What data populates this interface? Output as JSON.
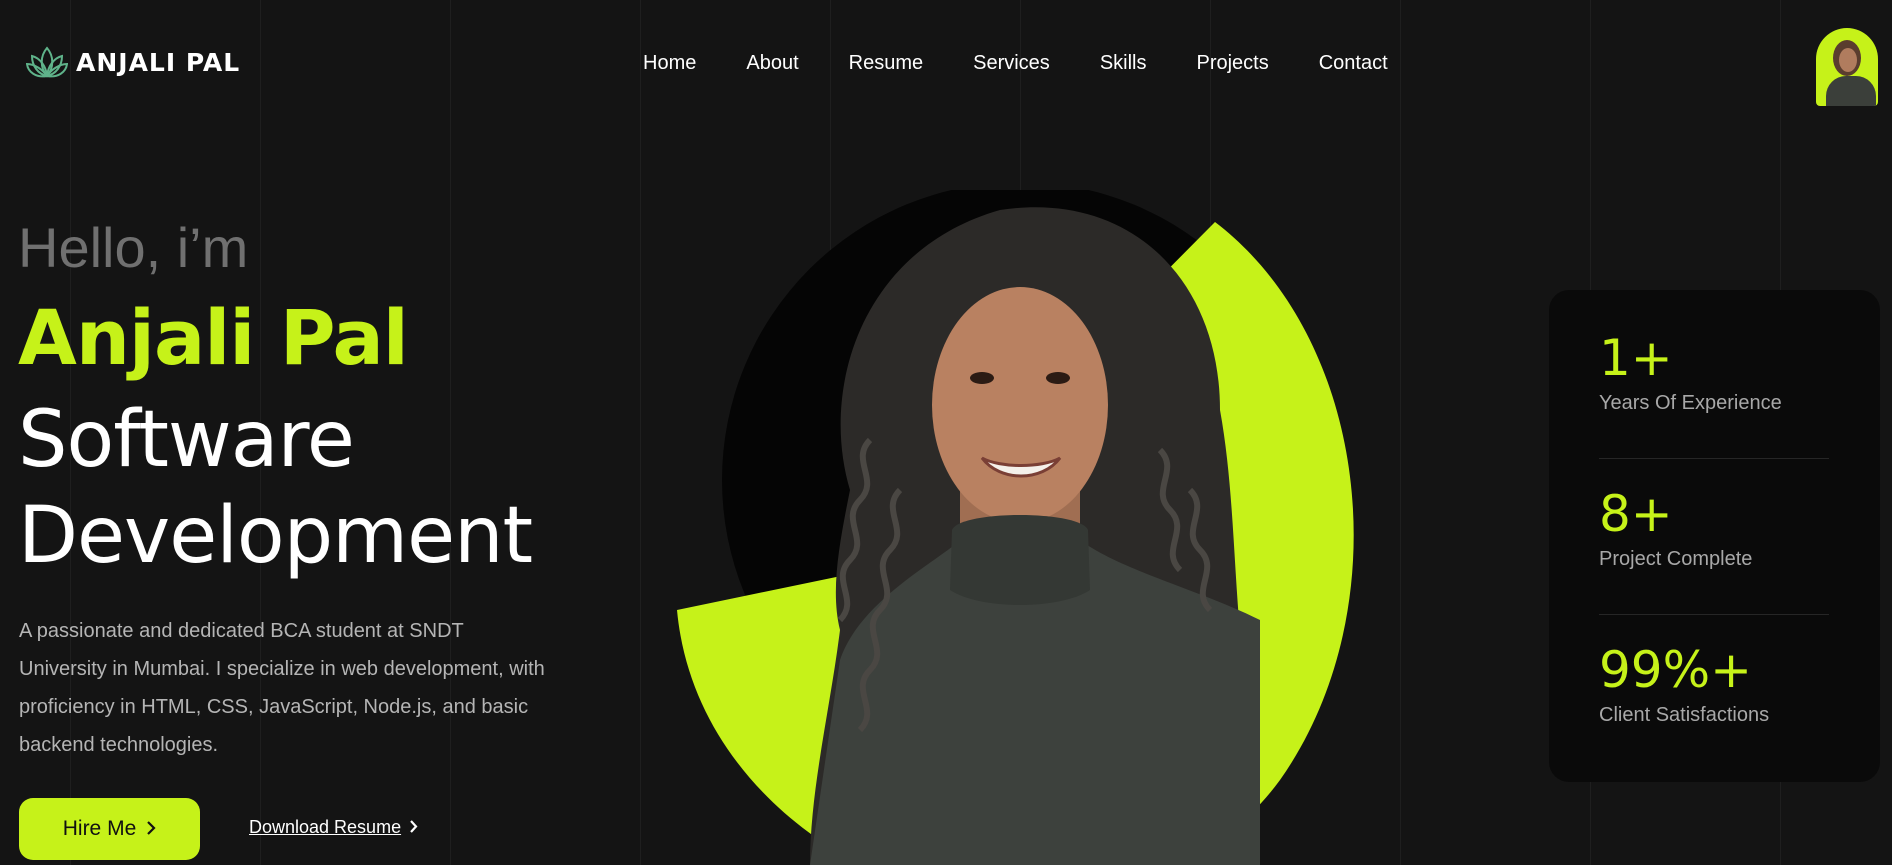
{
  "header": {
    "logo_text": "ANJALI PAL",
    "nav": [
      "Home",
      "About",
      "Resume",
      "Services",
      "Skills",
      "Projects",
      "Contact"
    ]
  },
  "hero": {
    "greeting": "Hello, i’m",
    "name": "Anjali Pal",
    "role_line1": "Software",
    "role_line2": "Development",
    "description": "A passionate and dedicated BCA student at SNDT University in Mumbai. I specialize in web development, with proficiency in HTML, CSS, JavaScript, Node.js, and basic backend technologies.",
    "hire_label": "Hire Me",
    "download_label": "Download Resume"
  },
  "stats": [
    {
      "value": "1+",
      "label": "Years Of Experience"
    },
    {
      "value": "8+",
      "label": "Project Complete"
    },
    {
      "value": "99%+",
      "label": "Client Satisfactions"
    }
  ],
  "colors": {
    "accent": "#c6f219",
    "background": "#141414",
    "card": "#0a0a0a"
  },
  "icons": {
    "logo": "lotus-icon",
    "hire": "chevron-right-icon",
    "download": "chevron-right-icon"
  }
}
